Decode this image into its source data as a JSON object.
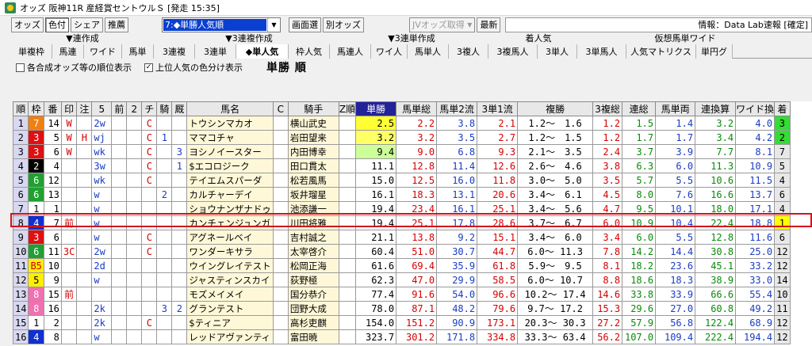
{
  "window": {
    "title": "オッズ 阪神11R 産経賞セントウルＳ [発走 15:35]"
  },
  "toolbar": {
    "buttons": [
      "オッズ",
      "色付",
      "シェア",
      "推薦"
    ],
    "combo_value": "7:◆単勝人気順",
    "buttons2": [
      "画面選",
      "別オッズ"
    ],
    "disabled_btn": "JVオッズ取得",
    "latest": "最新",
    "info": "情報：Data Lab速報 [確定]"
  },
  "groups": [
    "▼連作成",
    "▼3連複作成",
    "▼3連単作成",
    "着人気",
    "仮想馬単ワイド"
  ],
  "tabs": [
    "単複枠",
    "馬連",
    "ワイド",
    "馬単",
    "3連複",
    "3連単",
    "◆単人気",
    "枠人気",
    "馬連人",
    "ワイ人",
    "馬単人",
    "3複人",
    "3複馬人",
    "3単人",
    "3単馬人",
    "人気マトリクス",
    "単円グ"
  ],
  "options": {
    "opt1": "各合成オッズ等の順位表示",
    "opt2": "上位人気の色分け表示",
    "heading": "単勝 順"
  },
  "columns": [
    "順",
    "枠",
    "番",
    "印",
    "注",
    "5",
    "前",
    "2",
    "チ",
    "騎",
    "厩",
    "馬名",
    "C",
    "騎手",
    "Z順",
    "単勝",
    "馬単総",
    "馬単2流",
    "3単1流",
    "複勝",
    "3複総",
    "連総",
    "馬単両",
    "連換算",
    "ワイド換",
    "着"
  ],
  "colors": {
    "highlight": "#d0141e",
    "rank_yellow": "#ffff66",
    "accent_blue": "#0a3fd0"
  },
  "rows": [
    {
      "n": "1",
      "w": "7",
      "b": "14",
      "m": "W",
      "nt": "",
      "c5": "2w",
      "c6": "",
      "c7": "",
      "c8": "C",
      "c9": "",
      "c10": "",
      "name": "トウシンマカオ",
      "cc": "",
      "jky": "横山武史",
      "z": "",
      "tan": "2.5",
      "ut": "2.2",
      "u2": "3.8",
      "s1": "2.1",
      "fuk": "1.2～　1.6",
      "f3": "1.2",
      "rs": "1.5",
      "ur": "1.4",
      "rk": "3.2",
      "wk": "4.0",
      "ch": "3"
    },
    {
      "n": "2",
      "w": "3",
      "b": "5",
      "m": "W",
      "nt": "H",
      "c5": "wj",
      "c6": "",
      "c7": "",
      "c8": "C",
      "c9": "1",
      "c10": "",
      "name": "ママコチャ",
      "cc": "",
      "jky": "岩田望来",
      "z": "",
      "tan": "3.2",
      "ut": "3.2",
      "u2": "3.5",
      "s1": "2.7",
      "fuk": "1.2～　1.5",
      "f3": "1.2",
      "rs": "1.7",
      "ur": "1.7",
      "rk": "3.4",
      "wk": "4.2",
      "ch": "2"
    },
    {
      "n": "3",
      "w": "3",
      "b": "6",
      "m": "W",
      "nt": "",
      "c5": "wk",
      "c6": "",
      "c7": "",
      "c8": "C",
      "c9": "",
      "c10": "3",
      "name": "ヨシノイースター",
      "cc": "",
      "jky": "内田博幸",
      "z": "",
      "tan": "9.4",
      "ut": "9.0",
      "u2": "6.8",
      "s1": "9.3",
      "fuk": "2.1～　3.5",
      "f3": "2.4",
      "rs": "3.7",
      "ur": "3.9",
      "rk": "7.7",
      "wk": "8.1",
      "ch": "7"
    },
    {
      "n": "4",
      "w": "2",
      "b": "4",
      "m": "",
      "nt": "",
      "c5": "3w",
      "c6": "",
      "c7": "",
      "c8": "C",
      "c9": "",
      "c10": "1",
      "name": "$エコロジーク",
      "cc": "",
      "jky": "田口貫太",
      "z": "",
      "tan": "11.1",
      "ut": "12.8",
      "u2": "11.4",
      "s1": "12.6",
      "fuk": "2.6～　4.6",
      "f3": "3.8",
      "rs": "6.3",
      "ur": "6.0",
      "rk": "11.3",
      "wk": "10.9",
      "ch": "5"
    },
    {
      "n": "5",
      "w": "6",
      "b": "12",
      "m": "",
      "nt": "",
      "c5": "wk",
      "c6": "",
      "c7": "",
      "c8": "C",
      "c9": "",
      "c10": "",
      "name": "テイエムスパーダ",
      "cc": "",
      "jky": "松若風馬",
      "z": "",
      "tan": "15.0",
      "ut": "12.5",
      "u2": "16.0",
      "s1": "11.8",
      "fuk": "3.0～　5.0",
      "f3": "3.5",
      "rs": "5.7",
      "ur": "5.5",
      "rk": "10.6",
      "wk": "11.5",
      "ch": "4"
    },
    {
      "n": "6",
      "w": "6",
      "b": "13",
      "m": "",
      "nt": "",
      "c5": "w",
      "c6": "",
      "c7": "",
      "c8": "",
      "c9": "2",
      "c10": "",
      "name": "カルチャーデイ",
      "cc": "",
      "jky": "坂井瑠星",
      "z": "",
      "tan": "16.1",
      "ut": "18.3",
      "u2": "13.1",
      "s1": "20.6",
      "fuk": "3.4～　6.1",
      "f3": "4.5",
      "rs": "8.0",
      "ur": "7.6",
      "rk": "16.6",
      "wk": "13.7",
      "ch": "6"
    },
    {
      "n": "7",
      "w": "1",
      "b": "1",
      "m": "",
      "nt": "",
      "c5": "w",
      "c6": "",
      "c7": "",
      "c8": "",
      "c9": "",
      "c10": "",
      "name": "ショウナンザナドゥ",
      "cc": "",
      "jky": "池添謙一",
      "z": "",
      "tan": "19.4",
      "ut": "23.4",
      "u2": "16.1",
      "s1": "25.1",
      "fuk": "3.4～　5.6",
      "f3": "4.7",
      "rs": "9.5",
      "ur": "10.1",
      "rk": "18.0",
      "wk": "17.1",
      "ch": "4"
    },
    {
      "n": "8",
      "w": "4",
      "b": "7",
      "m": "前",
      "nt": "",
      "c5": "w",
      "c6": "",
      "c7": "",
      "c8": "",
      "c9": "",
      "c10": "",
      "name": "カンチェンジュンガ",
      "cc": "",
      "jky": "川田将雅",
      "z": "",
      "tan": "19.4",
      "ut": "25.1",
      "u2": "17.8",
      "s1": "28.6",
      "fuk": "3.7～　6.7",
      "f3": "6.0",
      "rs": "10.9",
      "ur": "10.4",
      "rk": "22.4",
      "wk": "18.8",
      "ch": "1"
    },
    {
      "n": "9",
      "w": "3",
      "b": "6",
      "m": "",
      "nt": "",
      "c5": "w",
      "c6": "",
      "c7": "",
      "c8": "C",
      "c9": "",
      "c10": "",
      "name": "アグネールベイ",
      "cc": "",
      "jky": "吉村誠之",
      "z": "",
      "tan": "21.1",
      "ut": "13.8",
      "u2": "9.2",
      "s1": "15.1",
      "fuk": "3.4～　6.0",
      "f3": "3.4",
      "rs": "6.0",
      "ur": "5.5",
      "rk": "12.8",
      "wk": "11.6",
      "ch": "6"
    },
    {
      "n": "10",
      "w": "6",
      "b": "11",
      "m": "3C",
      "nt": "",
      "c5": "2w",
      "c6": "",
      "c7": "",
      "c8": "C",
      "c9": "",
      "c10": "",
      "name": "ワンダーキサラ",
      "cc": "",
      "jky": "太宰啓介",
      "z": "",
      "tan": "60.4",
      "ut": "51.0",
      "u2": "30.7",
      "s1": "44.7",
      "fuk": "6.0～ 11.3",
      "f3": "7.8",
      "rs": "14.2",
      "ur": "14.4",
      "rk": "30.8",
      "wk": "25.0",
      "ch": "12"
    },
    {
      "n": "11",
      "w": "B5",
      "b": "10",
      "m": "",
      "nt": "",
      "c5": "2d",
      "c6": "",
      "c7": "",
      "c8": "",
      "c9": "",
      "c10": "",
      "name": "ウイングレイテスト",
      "cc": "",
      "jky": "松岡正海",
      "z": "",
      "tan": "61.6",
      "ut": "69.4",
      "u2": "35.9",
      "s1": "61.8",
      "fuk": "5.9～　9.5",
      "f3": "8.1",
      "rs": "18.2",
      "ur": "23.6",
      "rk": "45.1",
      "wk": "33.2",
      "ch": "12"
    },
    {
      "n": "12",
      "w": "5",
      "b": "9",
      "m": "",
      "nt": "",
      "c5": "w",
      "c6": "",
      "c7": "",
      "c8": "",
      "c9": "",
      "c10": "",
      "name": "ジャスティンスカイ",
      "cc": "",
      "jky": "荻野極",
      "z": "",
      "tan": "62.3",
      "ut": "47.0",
      "u2": "29.9",
      "s1": "58.5",
      "fuk": "6.0～ 10.7",
      "f3": "8.8",
      "rs": "18.6",
      "ur": "18.3",
      "rk": "38.9",
      "wk": "33.0",
      "ch": "14"
    },
    {
      "n": "13",
      "w": "8",
      "b": "15",
      "m": "前",
      "nt": "",
      "c5": "",
      "c6": "",
      "c7": "",
      "c8": "",
      "c9": "",
      "c10": "",
      "name": "モズメイメイ",
      "cc": "",
      "jky": "国分恭介",
      "z": "",
      "tan": "77.4",
      "ut": "91.6",
      "u2": "54.0",
      "s1": "96.6",
      "fuk": "10.2～ 17.4",
      "f3": "14.6",
      "rs": "33.8",
      "ur": "33.9",
      "rk": "66.6",
      "wk": "55.4",
      "ch": "10"
    },
    {
      "n": "14",
      "w": "8",
      "b": "16",
      "m": "",
      "nt": "",
      "c5": "2k",
      "c6": "",
      "c7": "",
      "c8": "",
      "c9": "3",
      "c10": "2",
      "name": "グランテスト",
      "cc": "",
      "jky": "団野大成",
      "z": "",
      "tan": "78.0",
      "ut": "87.1",
      "u2": "48.2",
      "s1": "79.6",
      "fuk": "9.7～ 17.2",
      "f3": "15.3",
      "rs": "29.6",
      "ur": "27.0",
      "rk": "60.8",
      "wk": "49.2",
      "ch": "11"
    },
    {
      "n": "15",
      "w": "1",
      "b": "2",
      "m": "",
      "nt": "",
      "c5": "2k",
      "c6": "",
      "c7": "",
      "c8": "C",
      "c9": "",
      "c10": "",
      "name": "$ティニア",
      "cc": "",
      "jky": "高杉吏麒",
      "z": "",
      "tan": "154.0",
      "ut": "151.2",
      "u2": "90.9",
      "s1": "173.1",
      "fuk": "20.3～ 30.3",
      "f3": "27.2",
      "rs": "57.9",
      "ur": "56.8",
      "rk": "122.4",
      "wk": "68.9",
      "ch": "12"
    },
    {
      "n": "16",
      "w": "4",
      "b": "8",
      "m": "",
      "nt": "",
      "c5": "w",
      "c6": "",
      "c7": "",
      "c8": "",
      "c9": "",
      "c10": "",
      "name": "レッドアヴァンティ",
      "cc": "",
      "jky": "富田暁",
      "z": "",
      "tan": "323.7",
      "ut": "301.2",
      "u2": "171.8",
      "s1": "334.8",
      "fuk": "33.3～ 63.4",
      "f3": "56.2",
      "rs": "107.0",
      "ur": "109.4",
      "rk": "222.4",
      "wk": "194.4",
      "ch": "12"
    }
  ]
}
